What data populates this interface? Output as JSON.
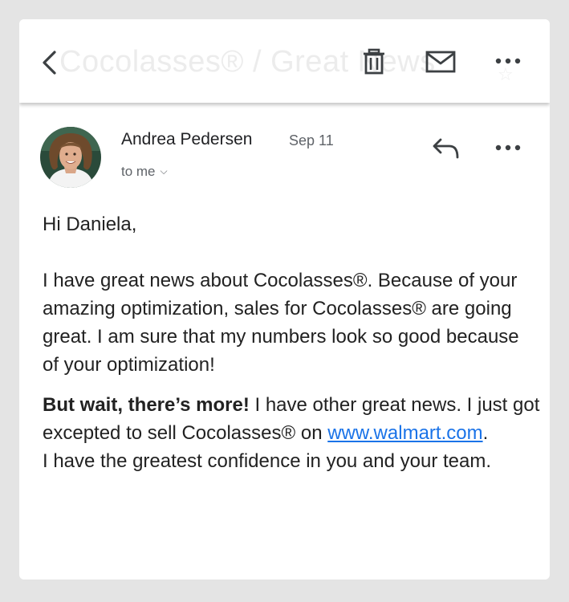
{
  "topbar": {
    "subject_ghost": "Cocolasses® / Great News",
    "back_label": "Back",
    "delete_label": "Delete",
    "mark_unread_label": "Mark as unread",
    "more_label": "More options"
  },
  "message": {
    "sender": "Andrea Pedersen",
    "date": "Sep 11",
    "recipient_line": "to me",
    "reply_label": "Reply",
    "more_label": "More message options"
  },
  "body": {
    "greeting": "Hi Daniela,",
    "para1": "I have great news about Cocolasses®.  Because of your amazing optimization, sales for Cocolasses® are going great.  I am sure that my numbers look so good because of your optimization!",
    "para2_bold": "But wait, there’s more!",
    "para2_text_a": "  I have other great news.  I just got excepted to sell Cocolasses® on ",
    "link_text": "www.walmart.com",
    "para2_text_b": ".",
    "para3": " I have the greatest confidence in you and your team."
  },
  "icons": {
    "back": "chevron-left-icon",
    "delete": "trash-icon",
    "mail": "envelope-icon",
    "more": "more-horizontal-icon",
    "reply": "reply-arrow-icon",
    "expand": "chevron-down-icon"
  },
  "colors": {
    "background": "#e4e4e4",
    "card": "#ffffff",
    "text": "#222222",
    "secondary_text": "#5f6368",
    "link": "#1a73e8",
    "icon": "#3c4043"
  }
}
